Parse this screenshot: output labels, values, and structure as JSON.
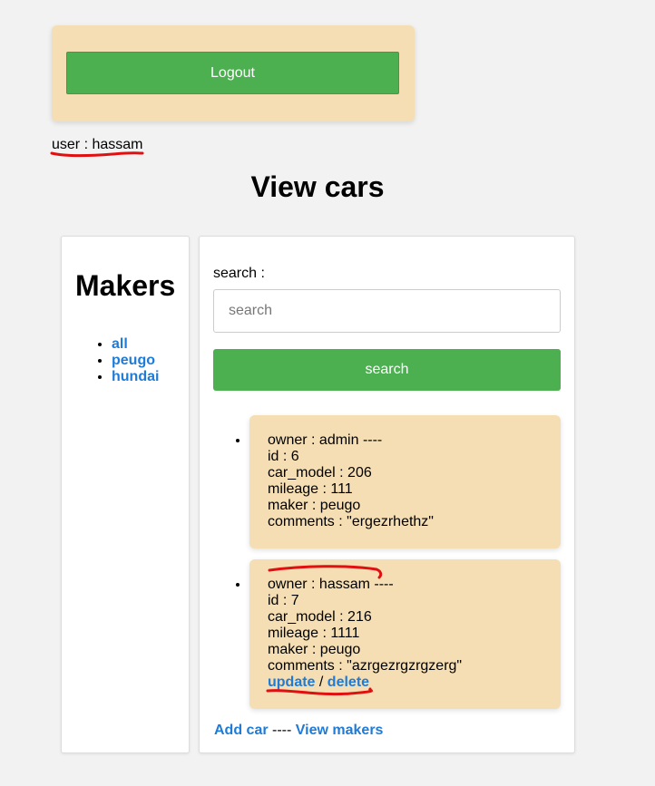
{
  "header": {
    "logout_label": "Logout",
    "user_prefix": "user : ",
    "username": "hassam"
  },
  "page_title": "View cars",
  "makers": {
    "title": "Makers",
    "items": [
      "all",
      "peugo",
      "hundai"
    ]
  },
  "search": {
    "label": "search :",
    "placeholder": "search",
    "value": "",
    "button_label": "search"
  },
  "cars": [
    {
      "owner": "owner : admin ----",
      "id": "id : 6",
      "car_model": "car_model : 206",
      "mileage": "mileage : 111",
      "maker": "maker : peugo",
      "comments": "comments : \"ergezrhethz\""
    },
    {
      "owner": "owner : hassam ----",
      "id": "id : 7",
      "car_model": "car_model : 216",
      "mileage": "mileage : 1111",
      "maker": "maker : peugo",
      "comments": "comments : \"azrgezrgzrgzerg\"",
      "update_label": "update",
      "separator": " / ",
      "delete_label": "delete"
    }
  ],
  "footer": {
    "add_car_label": "Add car",
    "separator": " ---- ",
    "view_makers_label": "View makers"
  },
  "colors": {
    "accent_green": "#4caf50",
    "card_bg": "#f5deb3",
    "link_blue": "#1e7bd8",
    "annotation_red": "#e01010"
  }
}
